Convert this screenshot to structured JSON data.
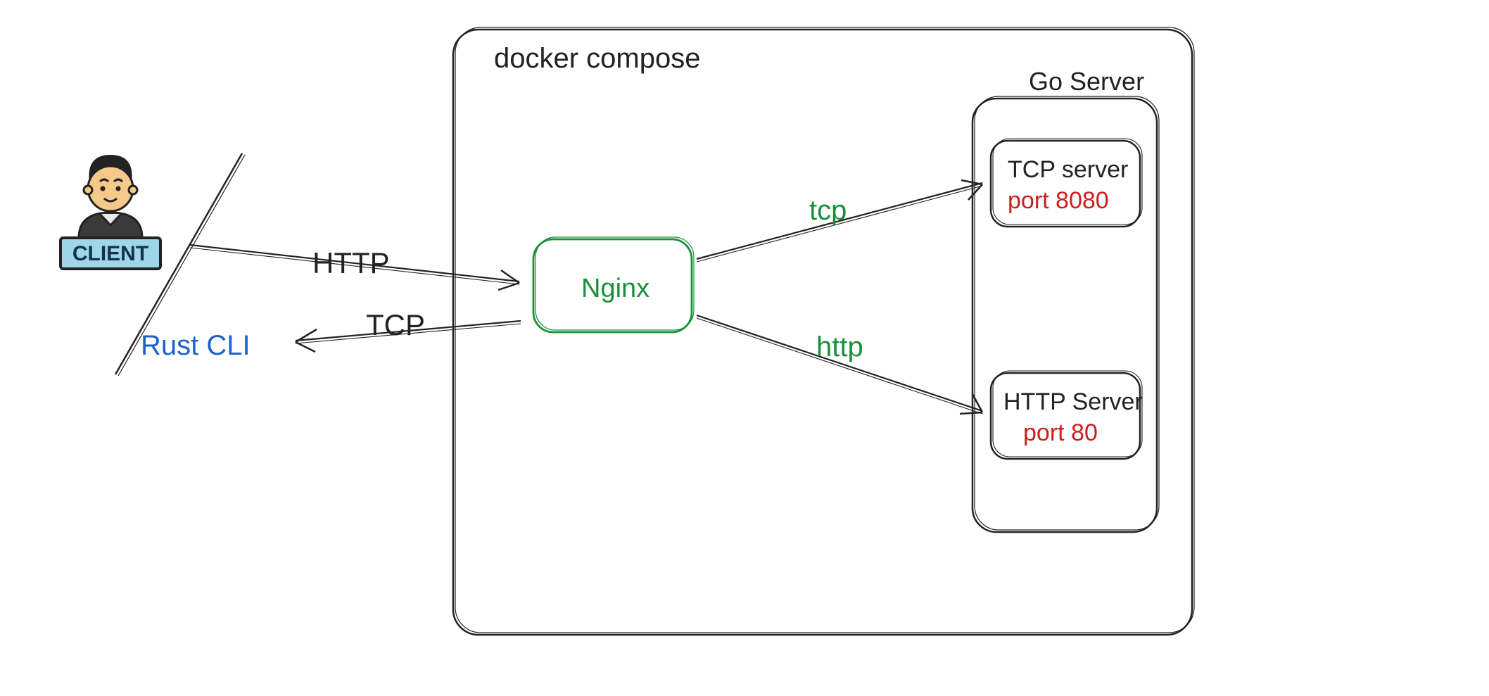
{
  "container": {
    "title": "docker compose"
  },
  "nginx": {
    "label": "Nginx"
  },
  "goServer": {
    "title": "Go Server"
  },
  "tcpServer": {
    "title": "TCP server",
    "port": "port 8080"
  },
  "httpServer": {
    "title": "HTTP Server",
    "port": "port 80"
  },
  "client": {
    "badge": "CLIENT",
    "tool": "Rust CLI"
  },
  "arrows": {
    "httpIn": "HTTP",
    "tcpIn": "TCP",
    "tcpOut": "tcp",
    "httpOut": "http"
  },
  "colors": {
    "black": "#222222",
    "green": "#1a8f3a",
    "red": "#cc1e1e",
    "blue": "#1e62cc",
    "lightBlue": "#9fd7e8"
  }
}
